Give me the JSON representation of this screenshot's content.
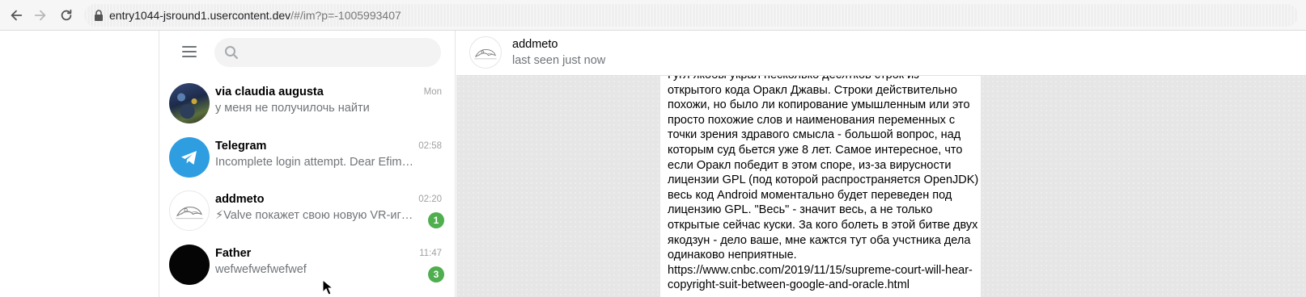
{
  "browser": {
    "url_host": "entry1044-jsround1.usercontent.dev",
    "url_path": "/#/im?p=-1005993407"
  },
  "sidebar": {
    "search_placeholder": "",
    "chats": [
      {
        "name": "via claudia augusta",
        "preview": "у меня не получилочь найти",
        "time": "Mon",
        "badge": "",
        "avatar": "photo"
      },
      {
        "name": "Telegram",
        "preview": "Incomplete login attempt. Dear Efim, Telegram b…",
        "time": "02:58",
        "badge": "",
        "avatar": "telegram"
      },
      {
        "name": "addmeto",
        "preview": "⚡Valve покажет свою новую VR-игру…",
        "time": "02:20",
        "badge": "1",
        "avatar": "sketch"
      },
      {
        "name": "Father",
        "preview": "wefwefwefwefwef",
        "time": "11:47",
        "badge": "3",
        "avatar": "dark"
      }
    ]
  },
  "header": {
    "name": "addmeto",
    "status": "last seen just now"
  },
  "message": {
    "lines": [
      "Гугл якобы украл несколько десятков строк из",
      "открытого кода Оракл Джавы. Строки действительно",
      "похожи, но было ли копирование умышленным или это",
      "просто похожие слов и наименования переменных с",
      "точки зрения здравого смысла - большой вопрос, над",
      "которым суд бьется уже 8 лет. Самое интересное, что",
      "если Оракл победит в этом споре, из-за вирусности",
      "лицензии GPL (под которой распространяется OpenJDK)",
      "весь код Android моментально будет переведен под",
      "лицензию GPL. \"Весь\" - значит весь, а не только",
      "открытые сейчас куски. За кого болеть в этой битве двух",
      "якодзун - дело ваше, мне кажтся тут оба учстника дела",
      "одинаково неприятные."
    ],
    "link_lines": [
      "https://www.cnbc.com/2019/11/15/supreme-court-will-hear-",
      "copyright-suit-between-google-and-oracle.html"
    ]
  },
  "colors": {
    "accent": "#2e9ee1",
    "badge": "#4fae4e",
    "muted": "#707579"
  }
}
